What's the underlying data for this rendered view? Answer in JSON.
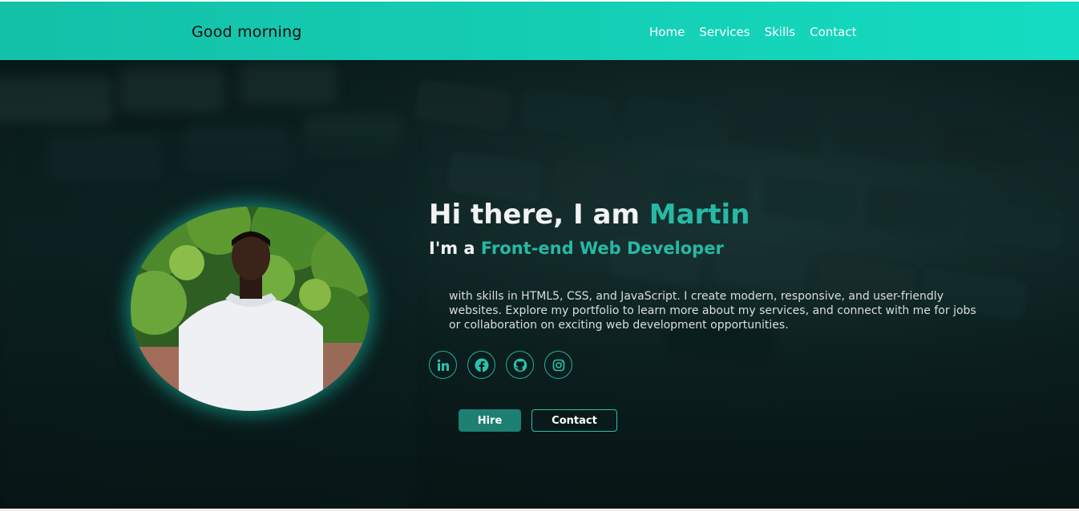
{
  "header": {
    "greeting": "Good morning",
    "nav": [
      "Home",
      "Services",
      "Skills",
      "Contact"
    ]
  },
  "hero": {
    "intro_prefix": "Hi there, I am ",
    "name": "Martin",
    "role_prefix": "I'm a ",
    "role": "Front-end Web Developer",
    "bio": "with skills in HTML5, CSS, and JavaScript. I create modern, responsive, and user-friendly websites. Explore my portfolio to learn more about my services, and connect with me for jobs or collaboration on exciting web development opportunities.",
    "socials": [
      "linkedin-icon",
      "facebook-icon",
      "github-icon",
      "instagram-icon"
    ],
    "buttons": {
      "hire": "Hire",
      "contact": "Contact"
    }
  },
  "colors": {
    "header_accent": "#14cdb3",
    "highlight": "#27b9a5",
    "button_fill": "#1e7f73"
  }
}
